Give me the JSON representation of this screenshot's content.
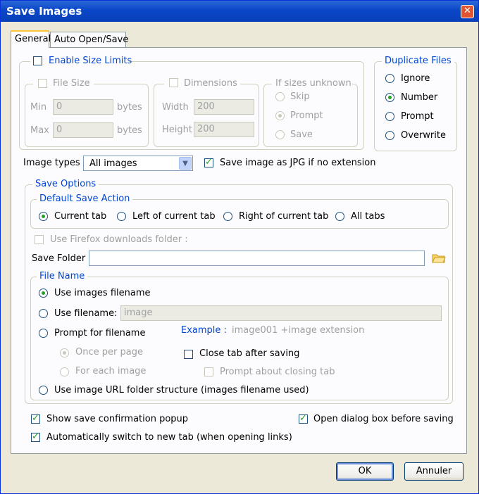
{
  "window": {
    "title": "Save Images",
    "close_glyph": "✕"
  },
  "tabs": [
    {
      "label": "General"
    },
    {
      "label": "Auto Open/Save"
    }
  ],
  "size_limits": {
    "enable_label": "Enable Size Limits",
    "file_size": {
      "legend": "File Size",
      "min_label": "Min",
      "min_value": "0",
      "max_label": "Max",
      "max_value": "0",
      "unit": "bytes"
    },
    "dimensions": {
      "legend": "Dimensions",
      "width_label": "Width",
      "width_value": "200",
      "height_label": "Height",
      "height_value": "200"
    },
    "if_unknown": {
      "legend": "If sizes unknown",
      "options": [
        "Skip",
        "Prompt",
        "Save"
      ],
      "selected": "Prompt"
    }
  },
  "duplicate_files": {
    "legend": "Duplicate Files",
    "options": [
      "Ignore",
      "Number",
      "Prompt",
      "Overwrite"
    ],
    "selected": "Number"
  },
  "image_types": {
    "label": "Image types",
    "value": "All images",
    "save_jpg_label": "Save image as JPG if no extension"
  },
  "save_options": {
    "legend": "Save Options",
    "default_action": {
      "legend": "Default Save Action",
      "options": [
        "Current tab",
        "Left of current tab",
        "Right of current tab",
        "All tabs"
      ],
      "selected": "Current tab"
    },
    "use_ff_downloads_label": "Use Firefox downloads folder :",
    "save_folder_label": "Save Folder",
    "save_folder_value": "",
    "file_name": {
      "legend": "File Name",
      "use_images_filename": "Use images filename",
      "use_filename": "Use filename:",
      "filename_value": "image",
      "prompt_for_filename": "Prompt for filename",
      "example_label": "Example :",
      "example_value": "image001 +image extension",
      "once_per_page": "Once per page",
      "for_each_image": "For each image",
      "close_tab_after_saving": "Close tab after saving",
      "prompt_about_closing": "Prompt about closing tab",
      "use_url_folder": "Use image URL folder structure (images filename used)"
    }
  },
  "bottom_options": {
    "show_confirm": "Show save confirmation popup",
    "open_dialog": "Open dialog box before saving",
    "auto_switch": "Automatically switch to new tab (when opening links)"
  },
  "buttons": {
    "ok": "OK",
    "cancel": "Annuler"
  },
  "colors": {
    "title_bar": "#0a47c8",
    "accent_blue": "#0046d5",
    "check_green": "#21a121"
  }
}
